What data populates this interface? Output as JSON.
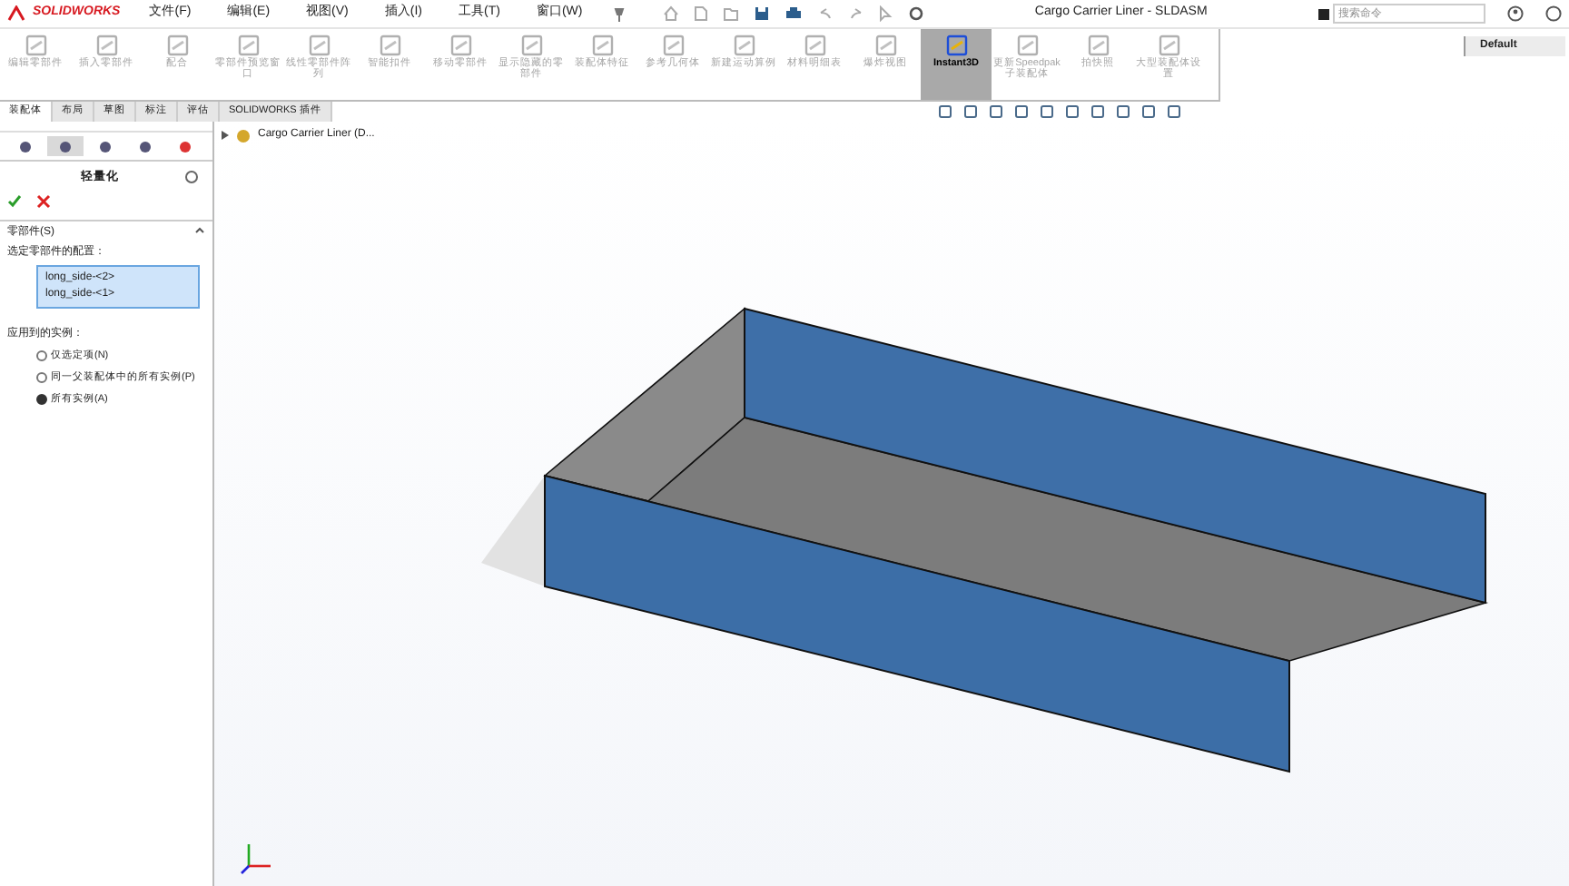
{
  "titlebar": {
    "logo": "SOLIDWORKS",
    "menus": [
      "文件(F)",
      "编辑(E)",
      "视图(V)",
      "插入(I)",
      "工具(T)",
      "窗口(W)"
    ],
    "title": "Cargo Carrier Liner - SLDASM",
    "search": {
      "placeholder": "搜索命令"
    }
  },
  "ribbon": {
    "tools": [
      {
        "label": "编辑零部件",
        "selected": false,
        "disabled": true
      },
      {
        "label": "插入零部件",
        "selected": false,
        "disabled": true
      },
      {
        "label": "配合",
        "selected": false,
        "disabled": true
      },
      {
        "label": "零部件预览窗口",
        "selected": false,
        "disabled": true
      },
      {
        "label": "线性零部件阵列",
        "selected": false,
        "disabled": true
      },
      {
        "label": "智能扣件",
        "selected": false,
        "disabled": true
      },
      {
        "label": "移动零部件",
        "selected": false,
        "disabled": true
      },
      {
        "label": "显示隐藏的零部件",
        "selected": false,
        "disabled": true
      },
      {
        "label": "装配体特征",
        "selected": false,
        "disabled": true
      },
      {
        "label": "参考几何体",
        "selected": false,
        "disabled": true
      },
      {
        "label": "新建运动算例",
        "selected": false,
        "disabled": true
      },
      {
        "label": "材料明细表",
        "selected": false,
        "disabled": true
      },
      {
        "label": "爆炸视图",
        "selected": false,
        "disabled": true
      },
      {
        "label": "Instant3D",
        "selected": true,
        "disabled": false
      },
      {
        "label": "更新Speedpak子装配体",
        "selected": false,
        "disabled": true
      },
      {
        "label": "拍快照",
        "selected": false,
        "disabled": true
      },
      {
        "label": "大型装配体设置",
        "selected": false,
        "disabled": true
      }
    ]
  },
  "configuration": {
    "label": "Default"
  },
  "tabs": [
    {
      "label": "装配体",
      "selected": true
    },
    {
      "label": "布局",
      "selected": false
    },
    {
      "label": "草图",
      "selected": false
    },
    {
      "label": "标注",
      "selected": false
    },
    {
      "label": "评估",
      "selected": false
    },
    {
      "label": "SOLIDWORKS 插件",
      "selected": false
    }
  ],
  "property_manager": {
    "title": "轻量化",
    "section": "零部件(S)",
    "list_label": "选定零部件的配置：",
    "components": [
      "long_side-<2>",
      "long_side-<1>"
    ],
    "instances_label": "应用到的实例：",
    "options": [
      {
        "label": "仅选定项(N)",
        "selected": false
      },
      {
        "label": "同一父装配体中的所有实例(P)",
        "selected": false
      },
      {
        "label": "所有实例(A)",
        "selected": true
      }
    ]
  },
  "tree": {
    "root": "Cargo Carrier Liner  (D..."
  }
}
